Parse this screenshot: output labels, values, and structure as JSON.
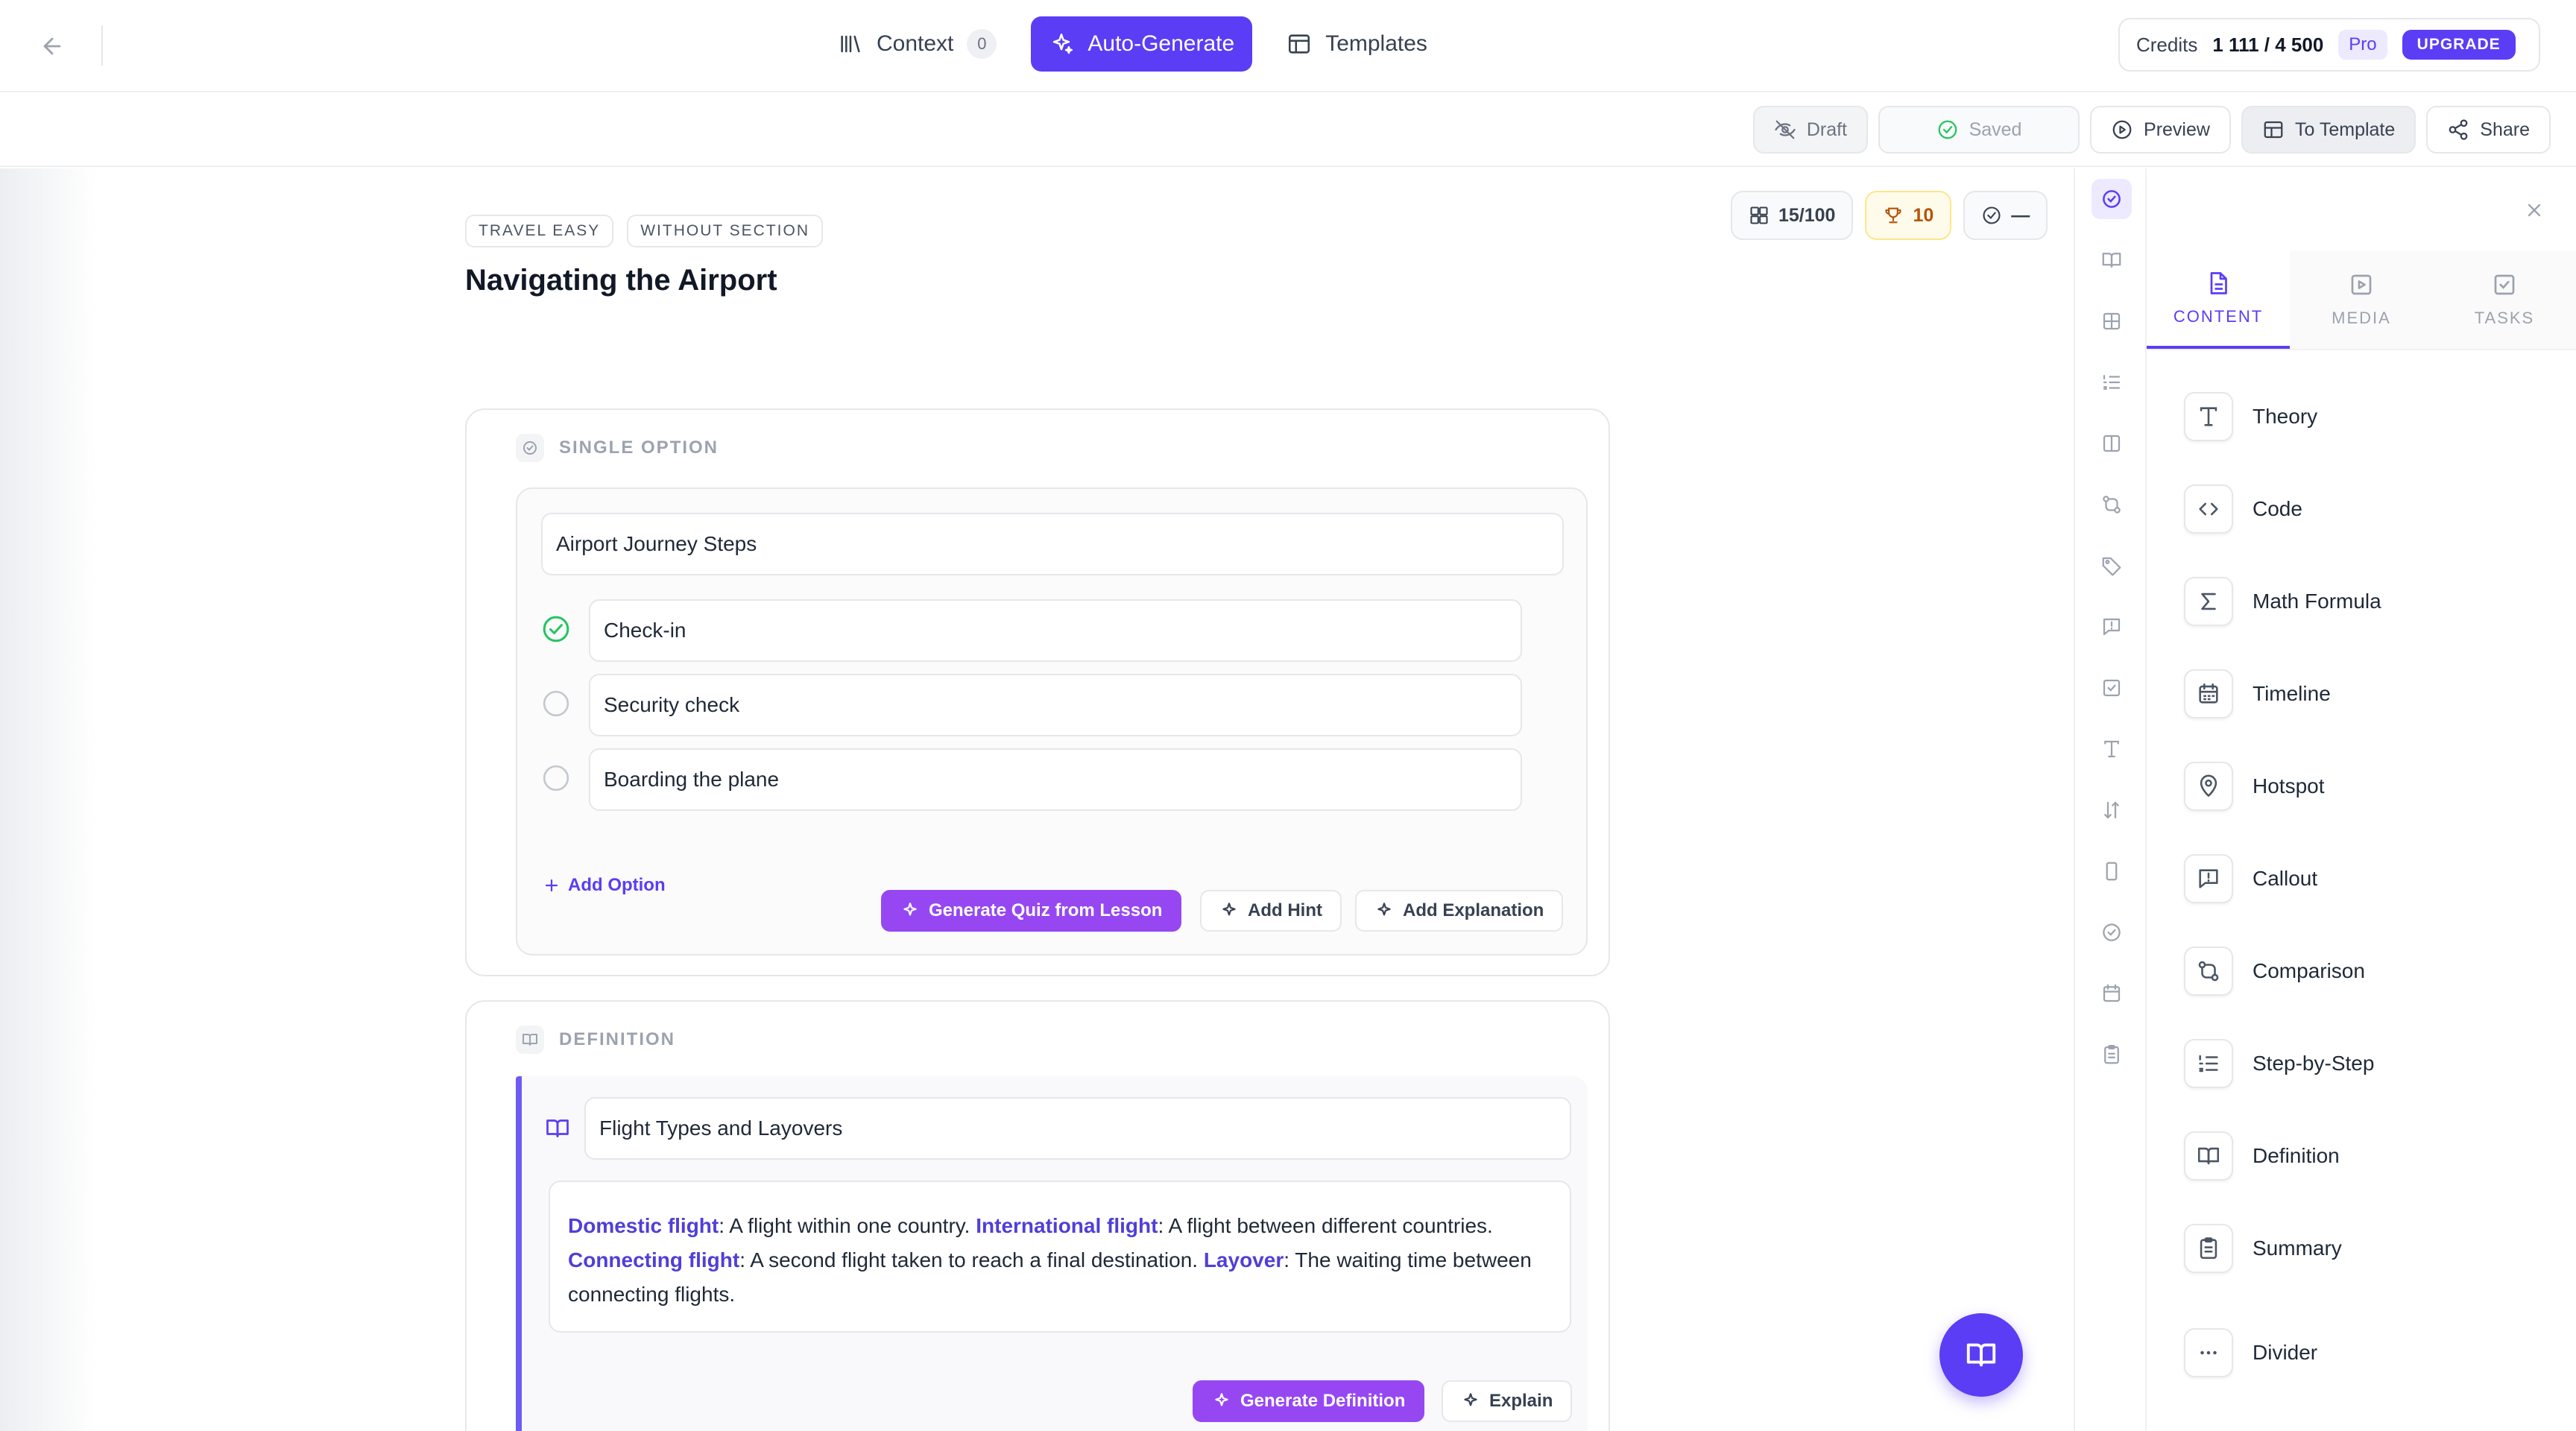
{
  "nav": {
    "context_label": "Context",
    "context_count": "0",
    "autogen_label": "Auto-Generate",
    "templates_label": "Templates"
  },
  "credits": {
    "label": "Credits",
    "value": "1 111 / 4 500",
    "plan": "Pro",
    "upgrade": "UPGRADE"
  },
  "toolbar": {
    "draft": "Draft",
    "saved": "Saved",
    "preview": "Preview",
    "to_template": "To Template",
    "share": "Share"
  },
  "lesson": {
    "breadcrumbs": [
      "TRAVEL EASY",
      "WITHOUT SECTION"
    ],
    "title": "Navigating the Airport",
    "stats": {
      "blocks": "15/100",
      "points": "10",
      "check": "—"
    }
  },
  "quiz": {
    "type_label": "SINGLE OPTION",
    "question": "Airport Journey Steps",
    "options": [
      {
        "text": "Check-in",
        "correct": true
      },
      {
        "text": "Security check",
        "correct": false
      },
      {
        "text": "Boarding the plane",
        "correct": false
      }
    ],
    "add_option": "Add Option",
    "generate_btn": "Generate Quiz from Lesson",
    "hint_btn": "Add Hint",
    "explanation_btn": "Add Explanation"
  },
  "definition": {
    "type_label": "DEFINITION",
    "title": "Flight Types and Layovers",
    "terms": [
      {
        "term": "Domestic flight",
        "text": ": A flight within one country. "
      },
      {
        "term": "International flight",
        "text": ": A flight between different countries. "
      },
      {
        "term": "Connecting flight",
        "text": ": A second flight taken to reach a final destination. "
      },
      {
        "term": "Layover",
        "text": ": The waiting time between connecting flights."
      }
    ],
    "generate_btn": "Generate Definition",
    "explain_btn": "Explain"
  },
  "panel": {
    "tabs": [
      "CONTENT",
      "MEDIA",
      "TASKS"
    ],
    "blocks": [
      "Theory",
      "Code",
      "Math Formula",
      "Timeline",
      "Hotspot",
      "Callout",
      "Comparison",
      "Step-by-Step",
      "Definition",
      "Summary",
      "Divider"
    ]
  },
  "colors": {
    "accent": "#5b3df5",
    "purple_button": "#9647f2",
    "success": "#22c55e",
    "term": "#4f3fd8"
  }
}
